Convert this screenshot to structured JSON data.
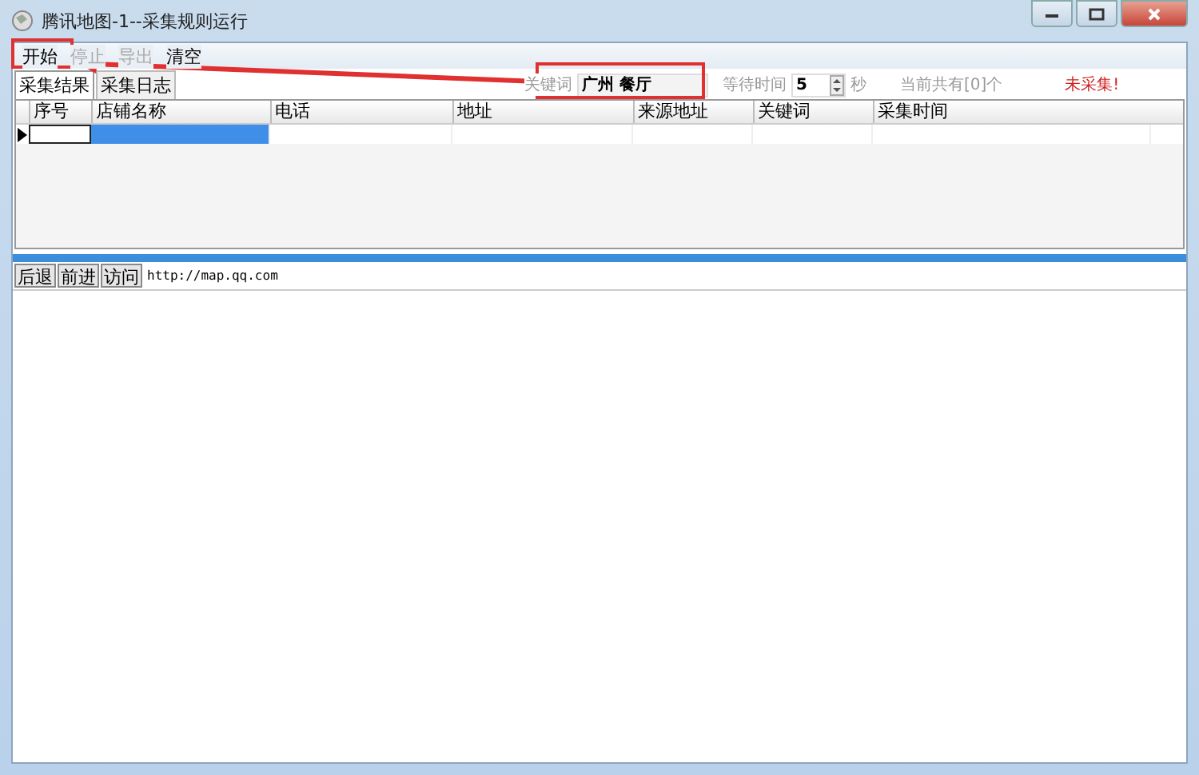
{
  "window": {
    "title": "腾讯地图-1--采集规则运行"
  },
  "menu": [
    {
      "label": "开始",
      "disabled": false
    },
    {
      "label": "停止",
      "disabled": true
    },
    {
      "label": "导出",
      "disabled": true
    },
    {
      "label": "清空",
      "disabled": false
    }
  ],
  "tabs": [
    {
      "label": "采集结果",
      "selected": true
    },
    {
      "label": "采集日志",
      "selected": false
    }
  ],
  "keyword": {
    "label": "关键词",
    "value": "广州 餐厅"
  },
  "wait": {
    "label": "等待时间",
    "value": "5",
    "unit": "秒"
  },
  "count": "当前共有[0]个",
  "status": "未采集!",
  "table": {
    "columns": [
      "序号",
      "店铺名称",
      "电话",
      "地址",
      "来源地址",
      "关键词",
      "采集时间"
    ],
    "rows": [
      {
        "current": true
      }
    ]
  },
  "nav": {
    "buttons": [
      "后退",
      "前进",
      "访问"
    ],
    "url": "http://map.qq.com"
  }
}
